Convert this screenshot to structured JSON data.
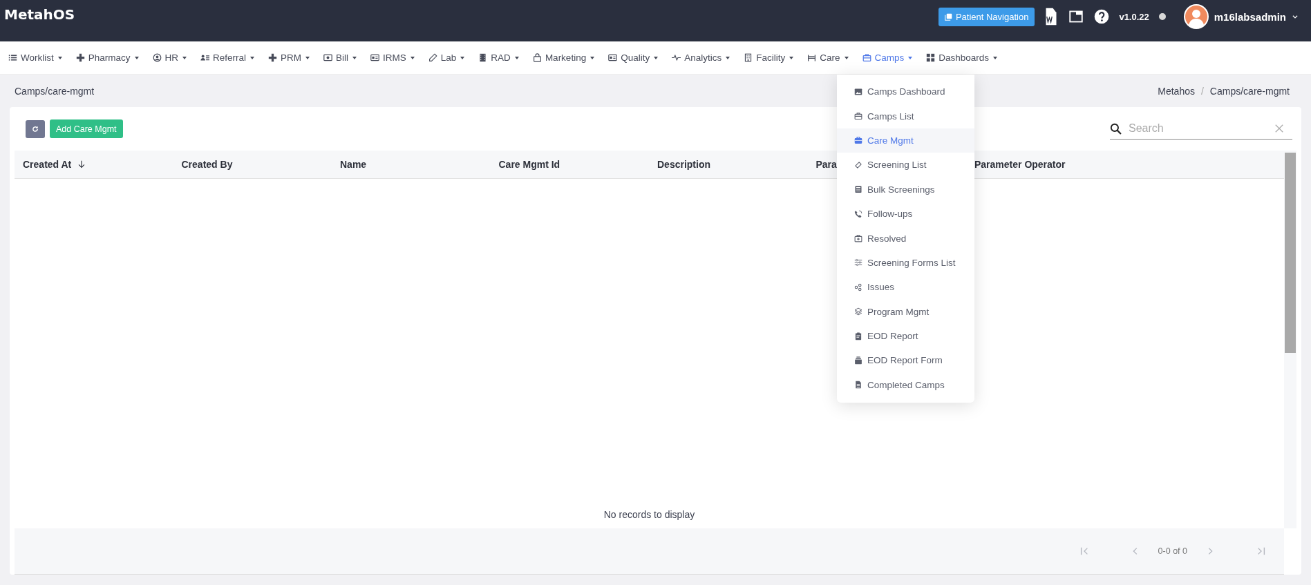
{
  "topbar": {
    "logo": "MetahOS",
    "patient_button": "Patient Navigation",
    "version": "v1.0.22",
    "user": "m16labsadmin"
  },
  "nav": [
    {
      "label": "Worklist",
      "selected": false
    },
    {
      "label": "Pharmacy",
      "selected": false
    },
    {
      "label": "HR",
      "selected": false
    },
    {
      "label": "Referral",
      "selected": false
    },
    {
      "label": "PRM",
      "selected": false
    },
    {
      "label": "Bill",
      "selected": false
    },
    {
      "label": "IRMS",
      "selected": false
    },
    {
      "label": "Lab",
      "selected": false
    },
    {
      "label": "RAD",
      "selected": false
    },
    {
      "label": "Marketing",
      "selected": false
    },
    {
      "label": "Quality",
      "selected": false
    },
    {
      "label": "Analytics",
      "selected": false
    },
    {
      "label": "Facility",
      "selected": false
    },
    {
      "label": "Care",
      "selected": false
    },
    {
      "label": "Camps",
      "selected": true
    },
    {
      "label": "Dashboards",
      "selected": false
    }
  ],
  "breadcrumb": {
    "title": "Camps/care-mgmt",
    "trail": [
      "Metahos",
      "Camps/care-mgmt"
    ],
    "separator": "/"
  },
  "toolbar": {
    "add_button": "Add Care Mgmt",
    "search": {
      "placeholder": "Search"
    }
  },
  "table": {
    "columns": [
      {
        "label": "Created At",
        "sorted": true
      },
      {
        "label": "Created By",
        "sorted": false
      },
      {
        "label": "Name",
        "sorted": false
      },
      {
        "label": "Care Mgmt Id",
        "sorted": false
      },
      {
        "label": "Description",
        "sorted": false
      },
      {
        "label": "Para",
        "sorted": false
      },
      {
        "label": "Parameter Operator",
        "sorted": false
      }
    ],
    "empty_message": "No records to display",
    "pagination": {
      "range": "0-0 of 0",
      "disabled": true
    }
  },
  "dropdown": [
    {
      "label": "Camps Dashboard",
      "selected": false
    },
    {
      "label": "Camps List",
      "selected": false
    },
    {
      "label": "Care Mgmt",
      "selected": true
    },
    {
      "label": "Screening List",
      "selected": false
    },
    {
      "label": "Bulk Screenings",
      "selected": false
    },
    {
      "label": "Follow-ups",
      "selected": false
    },
    {
      "label": "Resolved",
      "selected": false
    },
    {
      "label": "Screening Forms List",
      "selected": false
    },
    {
      "label": "Issues",
      "selected": false
    },
    {
      "label": "Program Mgmt",
      "selected": false
    },
    {
      "label": "EOD Report",
      "selected": false
    },
    {
      "label": "EOD Report Form",
      "selected": false
    },
    {
      "label": "Completed Camps",
      "selected": false
    }
  ]
}
